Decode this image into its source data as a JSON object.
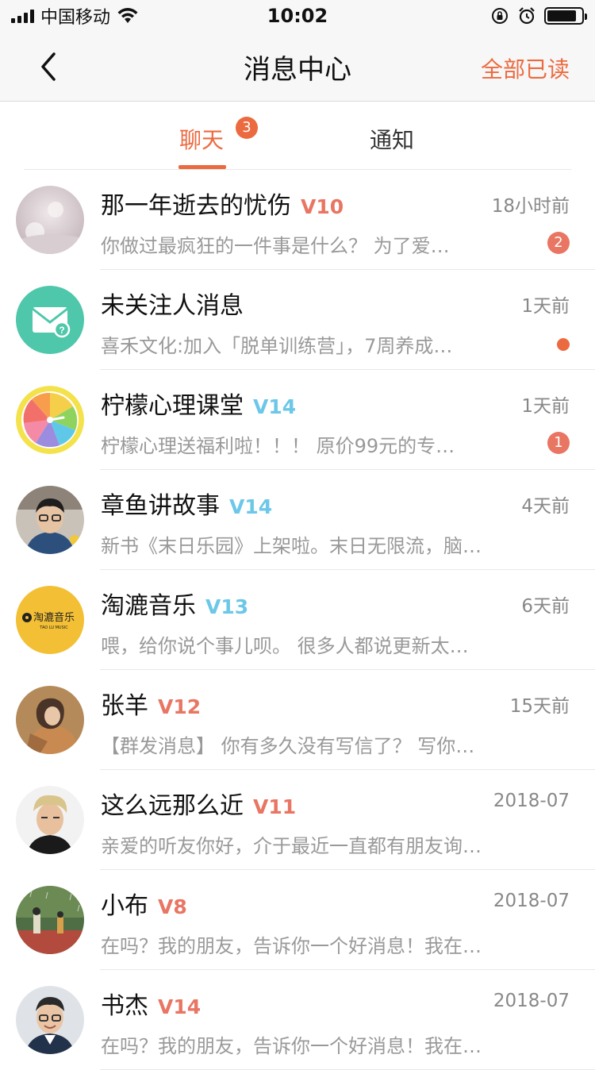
{
  "status_bar": {
    "carrier": "中国移动",
    "time": "10:02",
    "battery_level": 0.85
  },
  "nav": {
    "title": "消息中心",
    "mark_all_read": "全部已读",
    "back_icon": "chevron-left-icon"
  },
  "tabs": {
    "chat": "聊天",
    "chat_badge": "3",
    "notice": "通知"
  },
  "colors": {
    "accent": "#ec6a3f",
    "vip_red": "#e97563",
    "vip_blue": "#6cc7e8"
  },
  "messages": [
    {
      "name": "那一年逝去的忧伤",
      "vip": "V10",
      "vip_color": "red",
      "time": "18小时前",
      "preview": "你做过最疯狂的一件事是什么？ 为了爱…",
      "badge": "2",
      "avatar": "misty-photo-avatar"
    },
    {
      "name": "未关注人消息",
      "vip": "",
      "vip_color": "",
      "time": "1天前",
      "preview": "喜禾文化:加入「脱单训练营」，7周养成…",
      "dot": true,
      "avatar": "envelope-icon"
    },
    {
      "name": "柠檬心理课堂",
      "vip": "V14",
      "vip_color": "blue",
      "time": "1天前",
      "preview": "柠檬心理送福利啦！！！ 原价99元的专…",
      "badge": "1",
      "avatar": "lemon-clock-icon"
    },
    {
      "name": "章鱼讲故事",
      "vip": "V14",
      "vip_color": "blue",
      "time": "4天前",
      "preview": "新书《末日乐园》上架啦。末日无限流，脑…",
      "avatar": "man-glasses-photo-avatar"
    },
    {
      "name": "淘漉音乐",
      "vip": "V13",
      "vip_color": "blue",
      "time": "6天前",
      "preview": "喂，给你说个事儿呗。 很多人都说更新太…",
      "avatar": "tao-lu-music-logo",
      "logo_text": "淘漉音乐",
      "logo_sub": "TAO LU MUSIC"
    },
    {
      "name": "张羊",
      "vip": "V12",
      "vip_color": "red",
      "time": "15天前",
      "preview": "【群发消息】 你有多久没有写信了？ 写你…",
      "avatar": "illustrated-girl-avatar"
    },
    {
      "name": "这么远那么近",
      "vip": "V11",
      "vip_color": "red",
      "time": "2018-07",
      "preview": "亲爱的听友你好，介于最近一直都有朋友询…",
      "avatar": "blonde-man-photo-avatar"
    },
    {
      "name": "小布",
      "vip": "V8",
      "vip_color": "red",
      "time": "2018-07",
      "preview": "在吗？我的朋友，告诉你一个好消息！我在…",
      "avatar": "rain-illustration-avatar"
    },
    {
      "name": "书杰",
      "vip": "V14",
      "vip_color": "red",
      "time": "2018-07",
      "preview": "在吗？我的朋友，告诉你一个好消息！我在…",
      "avatar": "smiling-man-photo-avatar"
    }
  ]
}
